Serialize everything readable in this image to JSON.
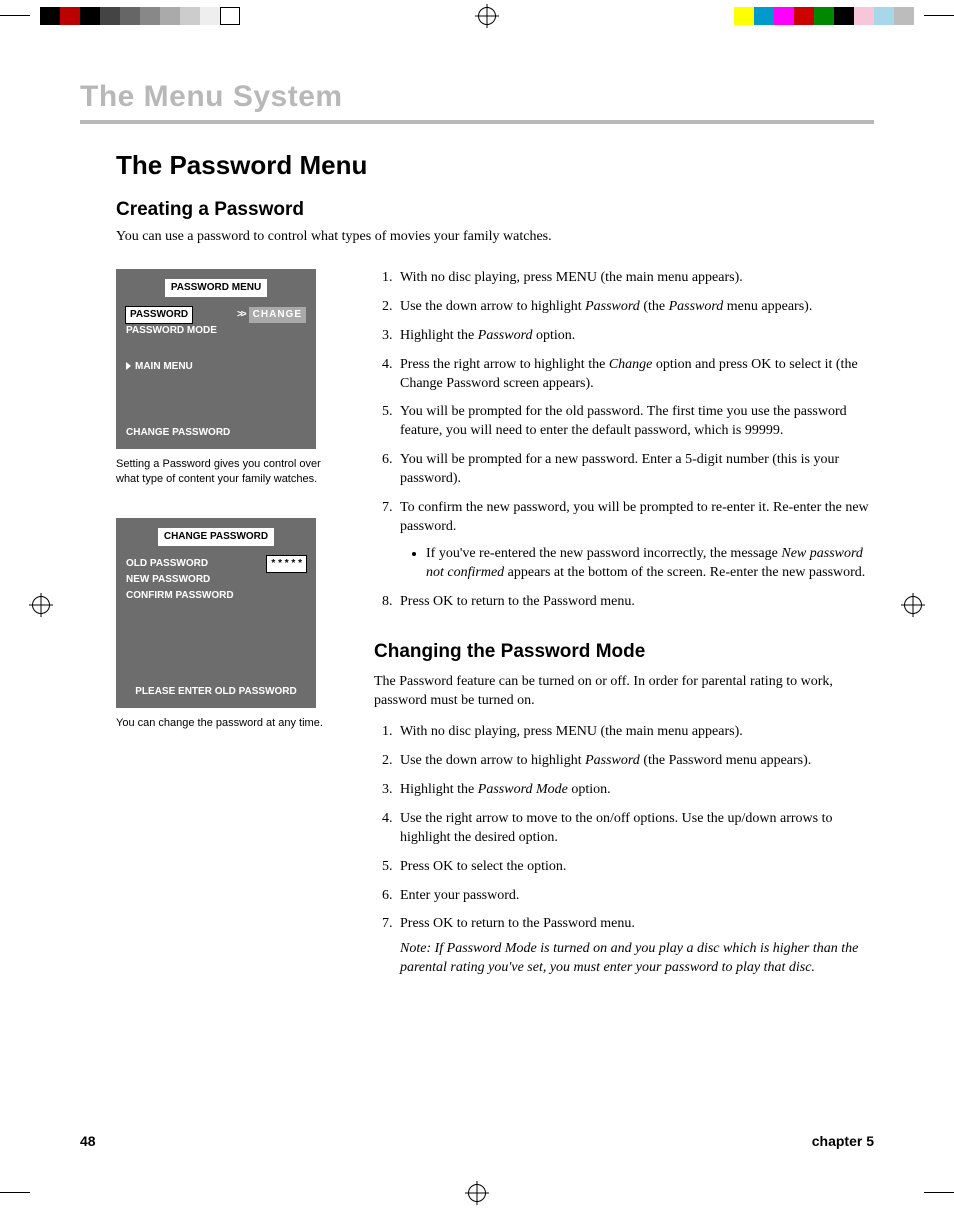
{
  "chapterHead": "The Menu System",
  "sectionTitle": "The Password Menu",
  "sub1": "Creating a Password",
  "lede": "You can use a password to control what types of movies your family watches.",
  "osd1": {
    "title": "PASSWORD MENU",
    "rowPassword": "PASSWORD",
    "rowChange": "CHANGE",
    "rowMode": "PASSWORD MODE",
    "mainMenu": "MAIN MENU",
    "bar": "CHANGE PASSWORD"
  },
  "caption1": "Setting a Password gives you control over what type of content your family watches.",
  "osd2": {
    "title": "CHANGE PASSWORD",
    "old": "OLD PASSWORD",
    "stars": "* * * * *",
    "new": "NEW PASSWORD",
    "confirm": "CONFIRM PASSWORD",
    "prompt": "PLEASE ENTER OLD PASSWORD"
  },
  "caption2": "You can change the password at any time.",
  "steps1": {
    "s1": "With no disc playing, press MENU (the main menu appears).",
    "s2a": "Use the down arrow to highlight ",
    "s2b": "Password",
    "s2c": " (the ",
    "s2d": "Password",
    "s2e": " menu appears).",
    "s3a": "Highlight the ",
    "s3b": "Password",
    "s3c": " option.",
    "s4a": "Press the right arrow to highlight the ",
    "s4b": "Change",
    "s4c": " option and press OK to select it (the Change Password screen appears).",
    "s5": "You will be prompted for the old password. The first time you use the password feature, you will need to enter the default password, which is 99999.",
    "s6": "You will be prompted for a new password. Enter a 5-digit number (this is your password).",
    "s7": "To confirm the new password, you will be prompted to re-enter it. Re-enter the new password.",
    "s7suba": "If you've re-entered the new password incorrectly, the message ",
    "s7subb": "New password not confirmed",
    "s7subc": " appears at the bottom of the screen. Re-enter the new password.",
    "s8": "Press OK to return to the Password menu."
  },
  "sub2": "Changing the Password Mode",
  "body2": "The Password feature can be turned on or off. In order for parental rating to work, password must be turned on.",
  "steps2": {
    "s1": "With no disc playing, press MENU (the main menu appears).",
    "s2a": "Use the down arrow to highlight ",
    "s2b": "Password",
    "s2c": " (the Password menu appears).",
    "s3a": "Highlight the ",
    "s3b": "Password Mode",
    "s3c": " option.",
    "s4": "Use the right arrow to move to the on/off options. Use the up/down arrows to highlight the desired option.",
    "s5": "Press OK to select the option.",
    "s6": "Enter your password.",
    "s7": "Press OK to return to the Password menu.",
    "note": "Note: If Password Mode is turned on and you play a disc which is higher than the parental rating you've set, you must enter your password to play that disc."
  },
  "footer": {
    "page": "48",
    "chapter": "chapter 5"
  },
  "colors": {
    "barsL": [
      "#000",
      "#ff0000",
      "#000",
      "#d32f2f",
      "#000",
      "#595959",
      "#7a7a7a",
      "#9c9c9c",
      "#bcbcbc",
      "#dcdcdc",
      "#fff"
    ],
    "barsR": [
      "#ffff00",
      "#00a8e8",
      "#ff00ff",
      "#d32f2f",
      "#008000",
      "#000",
      "#f7c6d9",
      "#a7d7e8",
      "#bcbcbc"
    ]
  }
}
